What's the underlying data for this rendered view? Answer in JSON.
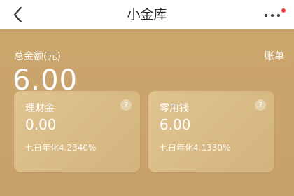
{
  "nav": {
    "title": "小金库",
    "back_icon": "chevron-left-icon",
    "more_icon": "more-horizontal-icon",
    "badge_color": "#f04040"
  },
  "summary": {
    "total_label": "总金额(元)",
    "total_amount": "6.00",
    "bill_link": "账单"
  },
  "cards": [
    {
      "title": "理财金",
      "value": "0.00",
      "rate": "七日年化4.2340%",
      "help_icon": "question-icon"
    },
    {
      "title": "零用钱",
      "value": "6.00",
      "rate": "七日年化4.1330%",
      "help_icon": "question-icon"
    }
  ],
  "colors": {
    "primary_gold": "#c9a56e",
    "card_gold": "#dcbf88",
    "text_light": "#ffffff"
  }
}
